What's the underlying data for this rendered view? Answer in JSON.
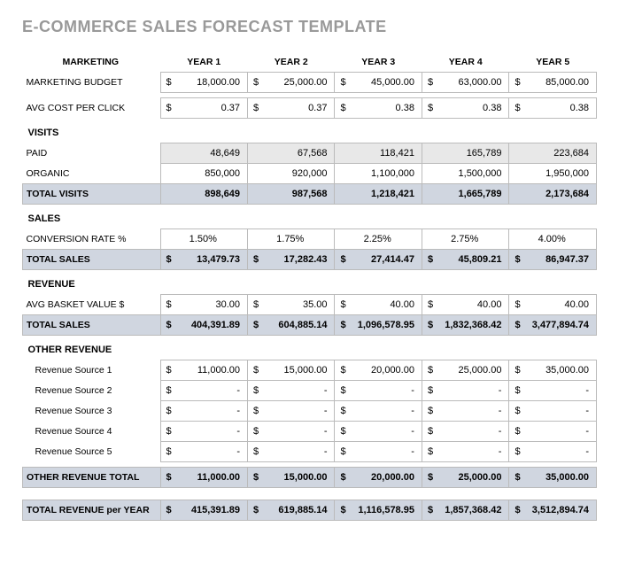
{
  "title": "E-COMMERCE SALES FORECAST TEMPLATE",
  "years": [
    "YEAR 1",
    "YEAR 2",
    "YEAR 3",
    "YEAR 4",
    "YEAR 5"
  ],
  "sections": {
    "marketing": {
      "label": "MARKETING",
      "rows": {
        "budget": {
          "label": "MARKETING BUDGET",
          "currency": "$",
          "values": [
            "18,000.00",
            "25,000.00",
            "45,000.00",
            "63,000.00",
            "85,000.00"
          ]
        },
        "cpc": {
          "label": "AVG COST PER CLICK",
          "currency": "$",
          "values": [
            "0.37",
            "0.37",
            "0.38",
            "0.38",
            "0.38"
          ]
        }
      }
    },
    "visits": {
      "label": "VISITS",
      "rows": {
        "paid": {
          "label": "PAID",
          "values": [
            "48,649",
            "67,568",
            "118,421",
            "165,789",
            "223,684"
          ]
        },
        "organic": {
          "label": "ORGANIC",
          "values": [
            "850,000",
            "920,000",
            "1,100,000",
            "1,500,000",
            "1,950,000"
          ]
        }
      },
      "total": {
        "label": "TOTAL VISITS",
        "values": [
          "898,649",
          "987,568",
          "1,218,421",
          "1,665,789",
          "2,173,684"
        ]
      }
    },
    "sales": {
      "label": "SALES",
      "rows": {
        "conv": {
          "label": "CONVERSION RATE %",
          "values": [
            "1.50%",
            "1.75%",
            "2.25%",
            "2.75%",
            "4.00%"
          ]
        }
      },
      "total": {
        "label": "TOTAL SALES",
        "currency": "$",
        "values": [
          "13,479.73",
          "17,282.43",
          "27,414.47",
          "45,809.21",
          "86,947.37"
        ]
      }
    },
    "revenue": {
      "label": "REVENUE",
      "rows": {
        "basket": {
          "label": "AVG BASKET VALUE $",
          "currency": "$",
          "values": [
            "30.00",
            "35.00",
            "40.00",
            "40.00",
            "40.00"
          ]
        }
      },
      "total": {
        "label": "TOTAL SALES",
        "currency": "$",
        "values": [
          "404,391.89",
          "604,885.14",
          "1,096,578.95",
          "1,832,368.42",
          "3,477,894.74"
        ]
      }
    },
    "other": {
      "label": "OTHER REVENUE",
      "rows": [
        {
          "label": "Revenue Source 1",
          "currency": "$",
          "values": [
            "11,000.00",
            "15,000.00",
            "20,000.00",
            "25,000.00",
            "35,000.00"
          ]
        },
        {
          "label": "Revenue Source 2",
          "currency": "$",
          "values": [
            "-",
            "-",
            "-",
            "-",
            "-"
          ]
        },
        {
          "label": "Revenue Source 3",
          "currency": "$",
          "values": [
            "-",
            "-",
            "-",
            "-",
            "-"
          ]
        },
        {
          "label": "Revenue Source 4",
          "currency": "$",
          "values": [
            "-",
            "-",
            "-",
            "-",
            "-"
          ]
        },
        {
          "label": "Revenue Source 5",
          "currency": "$",
          "values": [
            "-",
            "-",
            "-",
            "-",
            "-"
          ]
        }
      ],
      "total": {
        "label": "OTHER REVENUE TOTAL",
        "currency": "$",
        "values": [
          "11,000.00",
          "15,000.00",
          "20,000.00",
          "25,000.00",
          "35,000.00"
        ]
      }
    },
    "final": {
      "label": "TOTAL REVENUE per YEAR",
      "currency": "$",
      "values": [
        "415,391.89",
        "619,885.14",
        "1,116,578.95",
        "1,857,368.42",
        "3,512,894.74"
      ]
    }
  }
}
